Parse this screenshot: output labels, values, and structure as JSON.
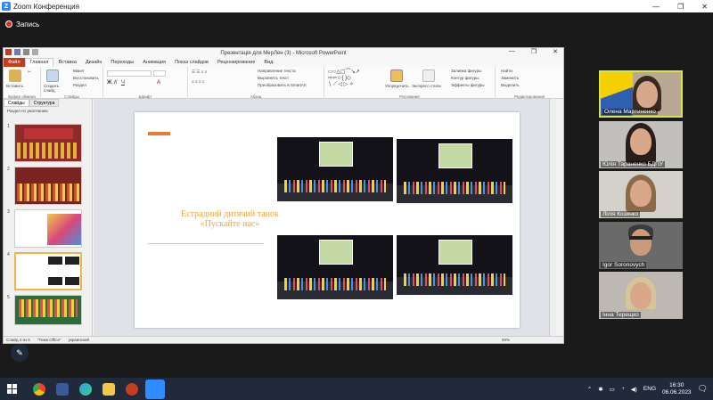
{
  "zoom": {
    "window_title": "Zoom Конференция",
    "recording_label": "Запись",
    "participants": [
      {
        "name": "Олена Мартиненко",
        "active": true
      },
      {
        "name": "Юлія Тараненко БДПУ",
        "active": false
      },
      {
        "name": "Лілія Козинко",
        "active": false
      },
      {
        "name": "Igor Soronovych",
        "active": false
      },
      {
        "name": "Інна Терещко",
        "active": false
      }
    ]
  },
  "ppt": {
    "window_title": "Презентація для МерЛен (3) - Microsoft PowerPoint",
    "tabs": [
      "Файл",
      "Главная",
      "Вставка",
      "Дизайн",
      "Переходы",
      "Анимация",
      "Показ слайдов",
      "Рецензирование",
      "Вид"
    ],
    "ribbon": {
      "paste": "Вставить",
      "create_slide": "Создать слайд",
      "layout": "Макет",
      "reset": "Восстановить",
      "section": "Раздел",
      "text_direction": "Направление текста",
      "align_text": "Выровнять текст",
      "smartart": "Преобразовать в SmartArt",
      "arrange": "Упорядочить",
      "quick_styles": "Экспресс-стили",
      "shape_fill": "Заливка фигуры",
      "shape_outline": "Контур фигуры",
      "shape_effects": "Эффекты фигуры",
      "find": "Найти",
      "replace": "Заменить",
      "select": "Выделить",
      "groups": {
        "clipboard": "Буфер обмена",
        "slides": "Слайды",
        "font": "Шрифт",
        "paragraph": "Абзац",
        "drawing": "Рисование",
        "editing": "Редактирование"
      }
    },
    "panel": {
      "tab_slides": "Слайды",
      "tab_outline": "Структура",
      "section_label": "Раздел по умолчанию",
      "slide_numbers": [
        "1",
        "2",
        "3",
        "4",
        "5"
      ]
    },
    "slide": {
      "title_line1": "Естрадний дитячий танок",
      "title_line2": "«Пускайте нас»"
    },
    "status": {
      "slide_info": "Слайд 4 из 6",
      "theme": "\"Тема Office\"",
      "lang": "украинский",
      "zoom": "69%"
    }
  },
  "taskbar": {
    "lang": "ENG",
    "time": "16:30",
    "date": "06.06.2023"
  }
}
